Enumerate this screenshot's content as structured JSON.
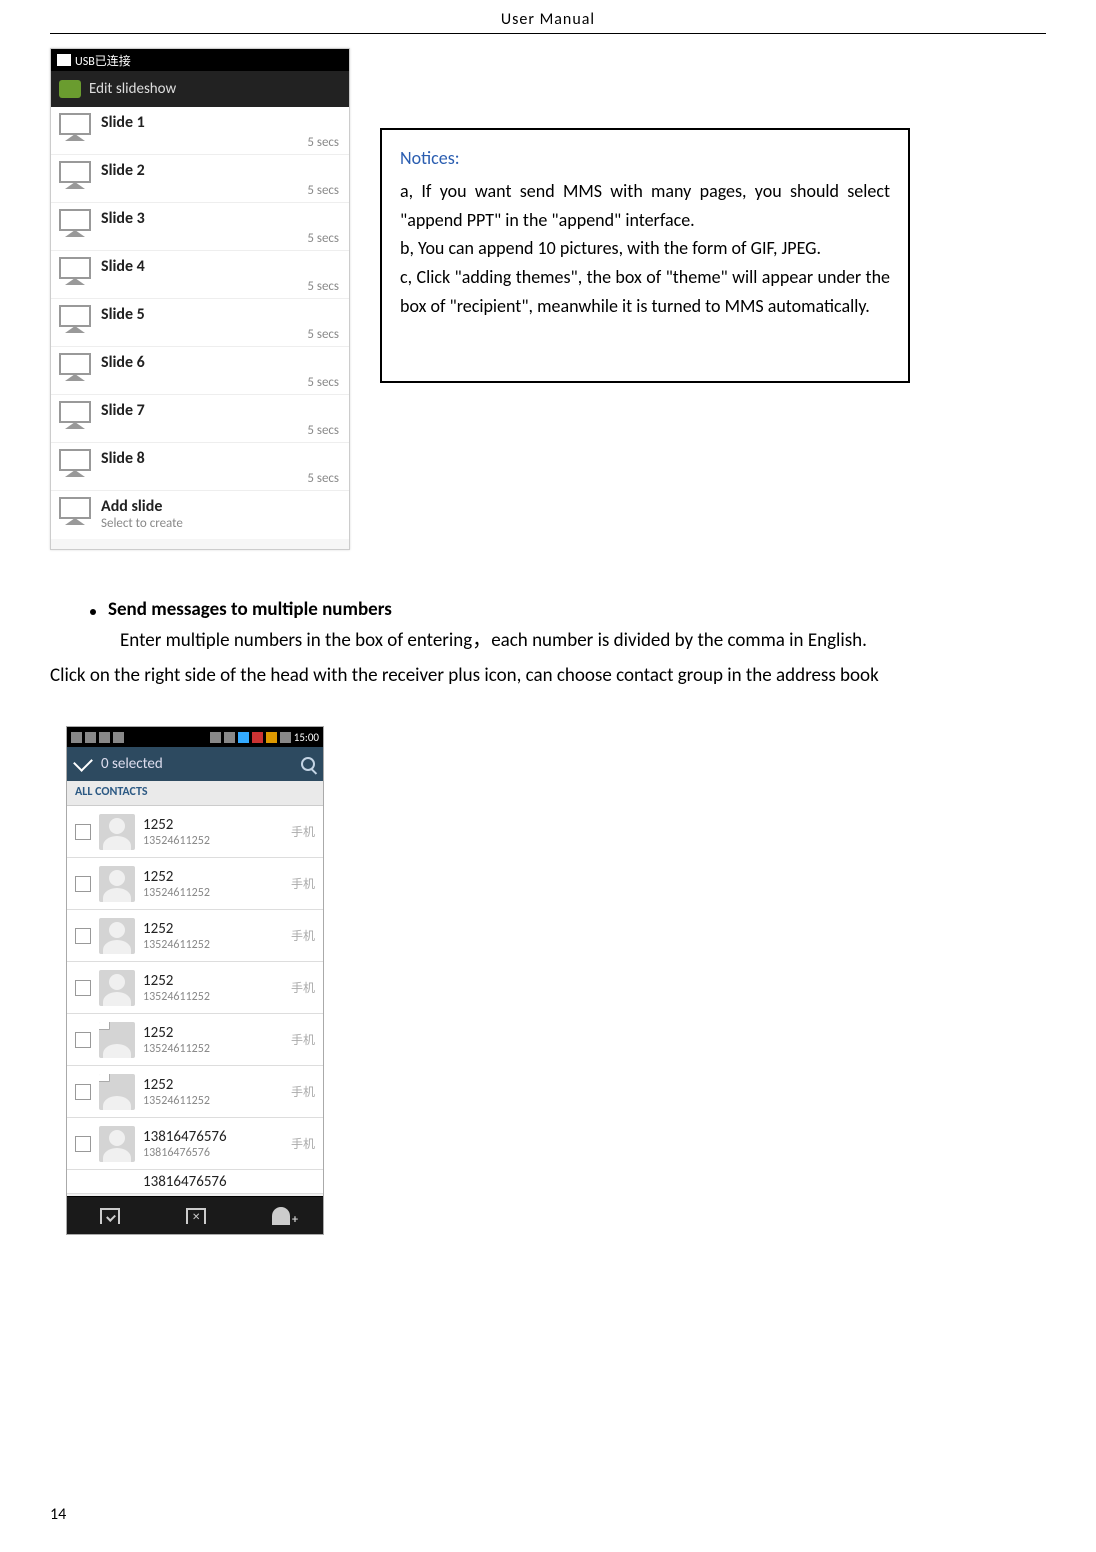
{
  "header": "User    Manual",
  "phone1": {
    "statusbar": "USB已连接",
    "title": "Edit slideshow",
    "slides": [
      {
        "title": "Slide 1",
        "secs": "5 secs"
      },
      {
        "title": "Slide 2",
        "secs": "5 secs"
      },
      {
        "title": "Slide 3",
        "secs": "5 secs"
      },
      {
        "title": "Slide 4",
        "secs": "5 secs"
      },
      {
        "title": "Slide 5",
        "secs": "5 secs"
      },
      {
        "title": "Slide 6",
        "secs": "5 secs"
      },
      {
        "title": "Slide 7",
        "secs": "5 secs"
      },
      {
        "title": "Slide 8",
        "secs": "5 secs"
      }
    ],
    "add_title": "Add slide",
    "add_sub": "Select to create"
  },
  "notices": {
    "title": "Notices:",
    "a": "a, If you want send MMS with many pages, you should select \"append PPT\" in the \"append\" interface.",
    "b": "b, You can append 10 pictures, with the form of GIF, JPEG.",
    "c": "c, Click \"adding themes\", the box of \"theme\" will appear under the box of \"recipient\", meanwhile it is turned to MMS automatically."
  },
  "section_title": "Send messages to multiple numbers",
  "body1": "Enter multiple numbers in the box of entering，each number is divided by the comma in English.",
  "body2": "Click on the right side of the head with the receiver plus icon, can choose contact group in the address book",
  "phone2": {
    "time": "15:00",
    "selected": "0 selected",
    "all": "ALL CONTACTS",
    "type": "手机",
    "contacts": [
      {
        "name": "1252",
        "num": "13524611252"
      },
      {
        "name": "1252",
        "num": "13524611252"
      },
      {
        "name": "1252",
        "num": "13524611252"
      },
      {
        "name": "1252",
        "num": "13524611252"
      },
      {
        "name": "1252",
        "num": "13524611252"
      },
      {
        "name": "1252",
        "num": "13524611252"
      },
      {
        "name": "13816476576",
        "num": "13816476576"
      }
    ],
    "partial_num": "13816476576"
  },
  "page_number": "14"
}
